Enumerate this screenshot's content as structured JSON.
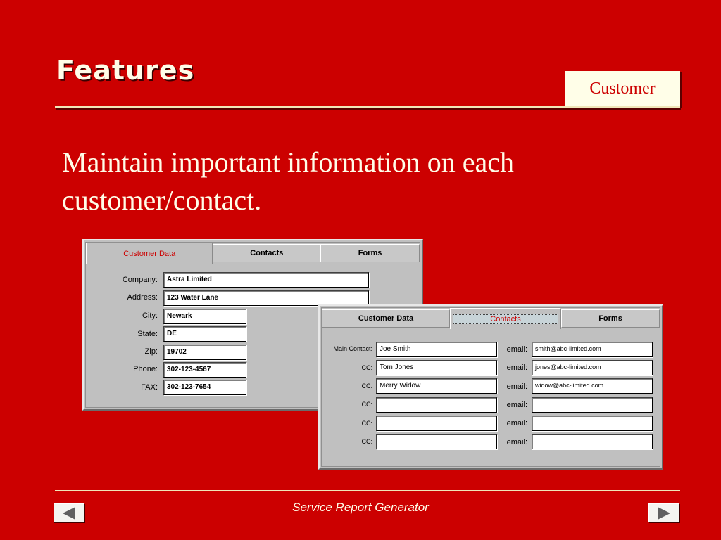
{
  "slide": {
    "title": "Features",
    "section_badge": "Customer",
    "body": "Maintain important information on each customer/contact.",
    "footer": "Service Report Generator"
  },
  "customer_window": {
    "tabs": [
      "Customer Data",
      "Contacts",
      "Forms"
    ],
    "active_tab": 0,
    "fields": [
      {
        "label": "Company:",
        "value": "Astra Limited"
      },
      {
        "label": "Address:",
        "value": "123 Water Lane"
      },
      {
        "label": "City:",
        "value": "Newark"
      },
      {
        "label": "State:",
        "value": "DE"
      },
      {
        "label": "Zip:",
        "value": "19702"
      },
      {
        "label": "Phone:",
        "value": "302-123-4567"
      },
      {
        "label": "FAX:",
        "value": "302-123-7654"
      }
    ]
  },
  "contacts_window": {
    "tabs": [
      "Customer Data",
      "Contacts",
      "Forms"
    ],
    "active_tab": 1,
    "email_label": "email:",
    "rows": [
      {
        "label": "Main Contact:",
        "name": "Joe Smith",
        "email": "smith@abc-limited.com"
      },
      {
        "label": "CC:",
        "name": "Tom Jones",
        "email": "jones@abc-limited.com"
      },
      {
        "label": "CC:",
        "name": "Merry Widow",
        "email": "widow@abc-limited.com"
      },
      {
        "label": "CC:",
        "name": "",
        "email": ""
      },
      {
        "label": "CC:",
        "name": "",
        "email": ""
      },
      {
        "label": "CC:",
        "name": "",
        "email": ""
      }
    ]
  },
  "nav": {
    "prev_icon": "left-triangle-icon",
    "next_icon": "right-triangle-icon"
  },
  "colors": {
    "background": "#cc0000",
    "text": "#fffde8",
    "accent_rule": "#f0e6b8"
  }
}
